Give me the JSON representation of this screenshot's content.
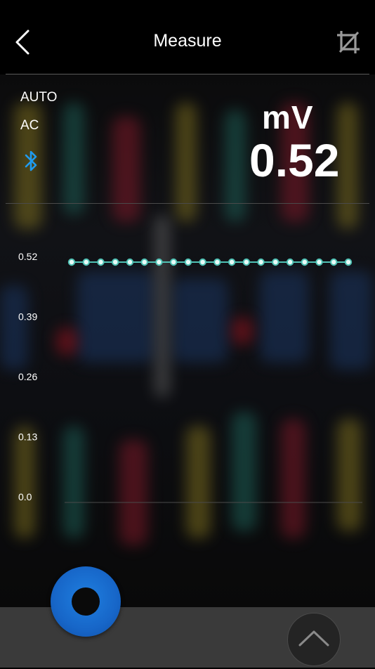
{
  "header": {
    "title": "Measure"
  },
  "status": {
    "mode": "AUTO",
    "coupling": "AC",
    "connection_icon": "bluetooth-icon"
  },
  "reading": {
    "unit": "mV",
    "value": "0.52"
  },
  "chart_data": {
    "type": "line",
    "y_ticks": [
      "0.52",
      "0.39",
      "0.26",
      "0.13",
      "0.0"
    ],
    "ylim": [
      0,
      0.52
    ],
    "x": [
      1,
      2,
      3,
      4,
      5,
      6,
      7,
      8,
      9,
      10,
      11,
      12,
      13,
      14,
      15,
      16,
      17,
      18,
      19,
      20
    ],
    "series": [
      {
        "values": [
          0.52,
          0.52,
          0.52,
          0.52,
          0.52,
          0.52,
          0.52,
          0.52,
          0.52,
          0.52,
          0.52,
          0.52,
          0.52,
          0.52,
          0.52,
          0.52,
          0.52,
          0.52,
          0.52,
          0.52
        ]
      }
    ],
    "grid": false
  },
  "colors": {
    "accent": "#1d7fe0",
    "line": "#4fc1b4",
    "bluetooth": "#1f9bf0",
    "bottom_bar": "#3a3a3a"
  },
  "controls": {
    "record_icon": "record-icon",
    "expand_icon": "chevron-up-icon"
  }
}
